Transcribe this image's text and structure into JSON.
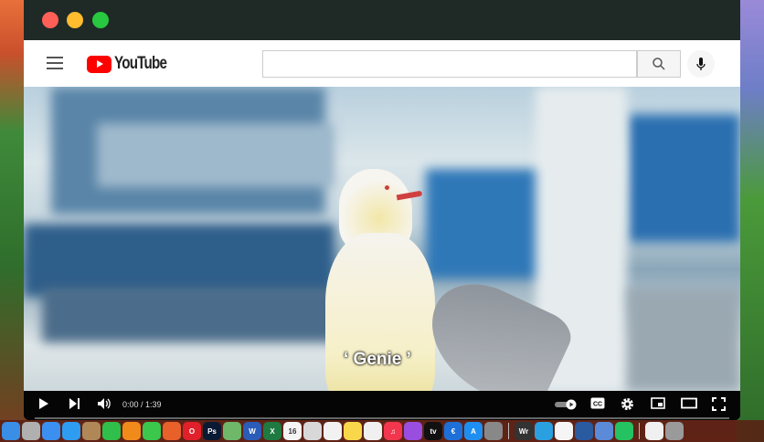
{
  "window": {
    "traffic_lights": {
      "close": "#fe5f57",
      "minimize": "#febc2e",
      "maximize": "#28c840"
    }
  },
  "header": {
    "logo_text": "YouTube",
    "search_placeholder": "",
    "search_icon": "search-icon",
    "mic_icon": "microphone-icon",
    "menu_icon": "hamburger-icon"
  },
  "video": {
    "caption": "‘ Genie ’"
  },
  "player": {
    "time": "0:00 / 1:39",
    "progress": 0
  },
  "dock": {
    "apps": [
      {
        "name": "finder",
        "color": "#3a8ee6",
        "label": ""
      },
      {
        "name": "launchpad",
        "color": "#b0b0b0",
        "label": ""
      },
      {
        "name": "mail",
        "color": "#3b8ff0",
        "label": ""
      },
      {
        "name": "safari",
        "color": "#2e9cf0",
        "label": ""
      },
      {
        "name": "notes-brown",
        "color": "#b08858",
        "label": ""
      },
      {
        "name": "facetime",
        "color": "#2fbf4a",
        "label": ""
      },
      {
        "name": "orange-app",
        "color": "#f08a1a",
        "label": ""
      },
      {
        "name": "messages",
        "color": "#3ac74c",
        "label": ""
      },
      {
        "name": "firefox",
        "color": "#e8602a",
        "label": ""
      },
      {
        "name": "opera",
        "color": "#e0202a",
        "label": "O"
      },
      {
        "name": "photoshop",
        "color": "#0b1a33",
        "label": "Ps"
      },
      {
        "name": "maps",
        "color": "#6fb86a",
        "label": ""
      },
      {
        "name": "word",
        "color": "#2b5cb8",
        "label": "W"
      },
      {
        "name": "excel",
        "color": "#1f7a42",
        "label": "X"
      },
      {
        "name": "calendar",
        "color": "#f4f4f4",
        "label": "16"
      },
      {
        "name": "screenshot",
        "color": "#d8d8d8",
        "label": ""
      },
      {
        "name": "reminders",
        "color": "#f2f2f2",
        "label": ""
      },
      {
        "name": "notes",
        "color": "#f8d84a",
        "label": ""
      },
      {
        "name": "freeform",
        "color": "#f0f0f0",
        "label": ""
      },
      {
        "name": "music",
        "color": "#f2364e",
        "label": "♫"
      },
      {
        "name": "podcasts",
        "color": "#9a4ee0",
        "label": ""
      },
      {
        "name": "apple-tv",
        "color": "#111111",
        "label": "tv"
      },
      {
        "name": "euro-app",
        "color": "#1e70d8",
        "label": "€"
      },
      {
        "name": "app-store",
        "color": "#1e8ff0",
        "label": "A"
      },
      {
        "name": "system-settings",
        "color": "#888888",
        "label": ""
      },
      {
        "name": "wr-app",
        "color": "#333333",
        "label": "Wr"
      },
      {
        "name": "telegram",
        "color": "#2aa0e0",
        "label": ""
      },
      {
        "name": "microsoft",
        "color": "#f5f5f5",
        "label": ""
      },
      {
        "name": "books",
        "color": "#2a5aa0",
        "label": ""
      },
      {
        "name": "preview",
        "color": "#5a8ad8",
        "label": ""
      },
      {
        "name": "whatsapp",
        "color": "#25c262",
        "label": ""
      },
      {
        "name": "document",
        "color": "#f0f0f0",
        "label": ""
      },
      {
        "name": "trash",
        "color": "#9a9a9a",
        "label": ""
      }
    ]
  }
}
